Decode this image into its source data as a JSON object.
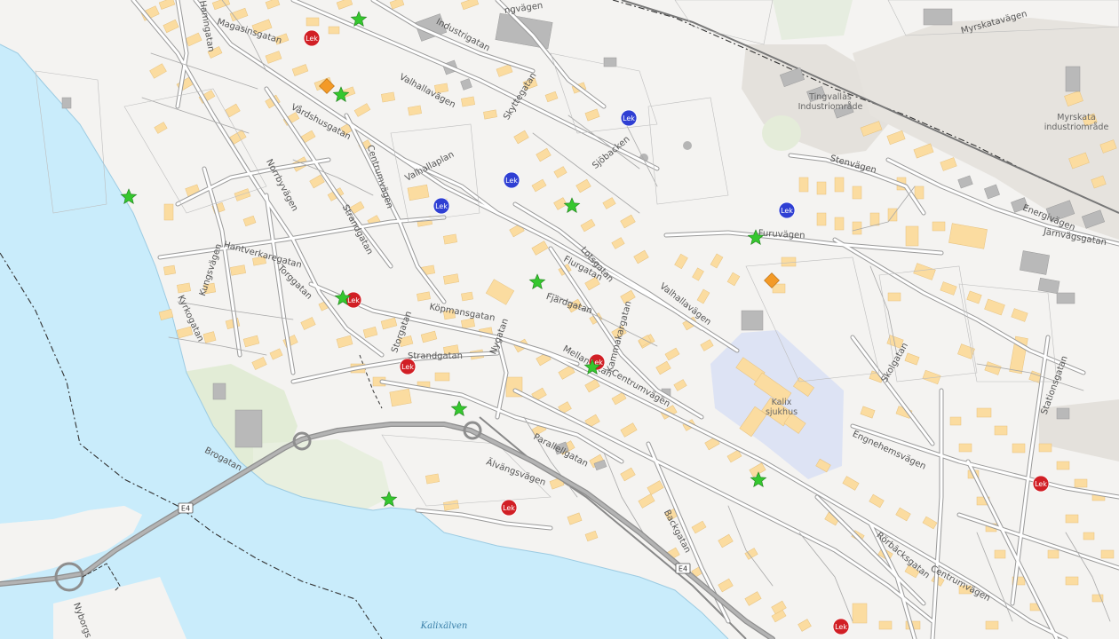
{
  "colors": {
    "water": "#c9ecfb",
    "land": "#f4f3f1",
    "building": "#fbdca0",
    "building_outline": "#e7c17c",
    "industrial": "#e4e1dc",
    "road": "#ffffff",
    "road_casing": "#8f8f8f",
    "highway": "#9b9b9b",
    "park": "#e2ecd6",
    "hospital": "#dde3f4",
    "accent": "#1aa3e8",
    "marker_red": "#d11f25",
    "marker_blue": "#2f3fd3",
    "marker_green_star": "#35c72e",
    "marker_orange": "#f39a27"
  },
  "roads": [
    {
      "name": "Magasinsgatan",
      "label": "Magasinsgatan"
    },
    {
      "name": "Hamngatan",
      "label": "Hamngatan"
    },
    {
      "name": "Industrigatan",
      "label": "Industrigatan"
    },
    {
      "name": "Tingvägen",
      "label": "ngvägen"
    },
    {
      "name": "Myrskatavägen",
      "label": "Myrskatavägen"
    },
    {
      "name": "Valhallavägen-north",
      "label": "Valhallavägen"
    },
    {
      "name": "Skyttegatan",
      "label": "Skyttegatan"
    },
    {
      "name": "Vårdshusgatan",
      "label": "Vårdshusgatan"
    },
    {
      "name": "Centrumvägen-north",
      "label": "Centrumvägen"
    },
    {
      "name": "Valhallaplan",
      "label": "Valhallaplan"
    },
    {
      "name": "Norrbyvägen",
      "label": "Norrbyvägen"
    },
    {
      "name": "Strandgatan-north",
      "label": "Strandgatan"
    },
    {
      "name": "Köpmansgatan",
      "label": "Köpmansgatan"
    },
    {
      "name": "Hantverkaregatan",
      "label": "Hantverkaregatan"
    },
    {
      "name": "Kungsvägen",
      "label": "Kungsvägen"
    },
    {
      "name": "Kyrkogatan",
      "label": "Kyrkogatan"
    },
    {
      "name": "Torggatan",
      "label": "Torggatan"
    },
    {
      "name": "Nygatan",
      "label": "Nygatan"
    },
    {
      "name": "Storgatan",
      "label": "Storgatan"
    },
    {
      "name": "Strandgatan",
      "label": "Strandgatan"
    },
    {
      "name": "Furuvägen",
      "label": "Furuvägen"
    },
    {
      "name": "Stenvägen",
      "label": "Stenvägen"
    },
    {
      "name": "Energivägen",
      "label": "Energivägen"
    },
    {
      "name": "Järnvägsgatan",
      "label": "Järnvägsgatan"
    },
    {
      "name": "Sjöbacken",
      "label": "Sjöbacken"
    },
    {
      "name": "Valhallavägen",
      "label": "Valhallavägen"
    },
    {
      "name": "Flurgatan",
      "label": "Flurgatan"
    },
    {
      "name": "Mellanngatan",
      "label": "Mellangatan"
    },
    {
      "name": "Centrumvägen",
      "label": "Centrumvägen"
    },
    {
      "name": "Parallellgatan",
      "label": "Parallellgatan"
    },
    {
      "name": "Älvängsvägen",
      "label": "Älvängsvägen"
    },
    {
      "name": "Brogatan",
      "label": "Brogatan"
    },
    {
      "name": "Backgatan",
      "label": "Backgatan"
    },
    {
      "name": "Skolgatan",
      "label": "Skolgatan"
    },
    {
      "name": "Stationsgatan",
      "label": "Stationsgatan"
    },
    {
      "name": "Engnehemsvägen",
      "label": "Engnehemsvägen"
    },
    {
      "name": "Centrumvägen-east",
      "label": "Centrumvägen"
    },
    {
      "name": "Rörbäcksgatan",
      "label": "Rörbäcksgatan"
    },
    {
      "name": "Nyborgsvägen",
      "label": "Nyborgs"
    },
    {
      "name": "Kammakargatan",
      "label": "Kammakargatan"
    },
    {
      "name": "Fjärdgatan",
      "label": "Fjärdgatan"
    },
    {
      "name": "Lotsgatan",
      "label": "Lotsgatan"
    }
  ],
  "place_labels": [
    {
      "name": "tingvallas-industriomrade",
      "line1": "Tingvallas",
      "line2": "Industriområde"
    },
    {
      "name": "myrskata-industriomrade",
      "line1": "Myrskata",
      "line2": "industriområde"
    },
    {
      "name": "kalix-sjukhus",
      "line1": "Kalix",
      "line2": "sjukhus"
    }
  ],
  "water_labels": [
    {
      "name": "kalixalven",
      "label": "Kalixälven"
    }
  ],
  "highway_shields": [
    {
      "name": "e4-shield-west",
      "label": "E4"
    },
    {
      "name": "e4-shield-south",
      "label": "E4"
    }
  ],
  "markers": {
    "lek_label": "Lek",
    "red_lek": [
      {
        "id": "red-lek-1"
      },
      {
        "id": "red-lek-2"
      },
      {
        "id": "red-lek-3"
      },
      {
        "id": "red-lek-4"
      },
      {
        "id": "red-lek-5"
      },
      {
        "id": "red-lek-6"
      },
      {
        "id": "red-lek-7"
      }
    ],
    "blue_lek": [
      {
        "id": "blue-lek-1"
      },
      {
        "id": "blue-lek-2"
      },
      {
        "id": "blue-lek-3"
      },
      {
        "id": "blue-lek-4"
      }
    ],
    "green_star_count": 12,
    "orange_diamond_count": 2
  }
}
